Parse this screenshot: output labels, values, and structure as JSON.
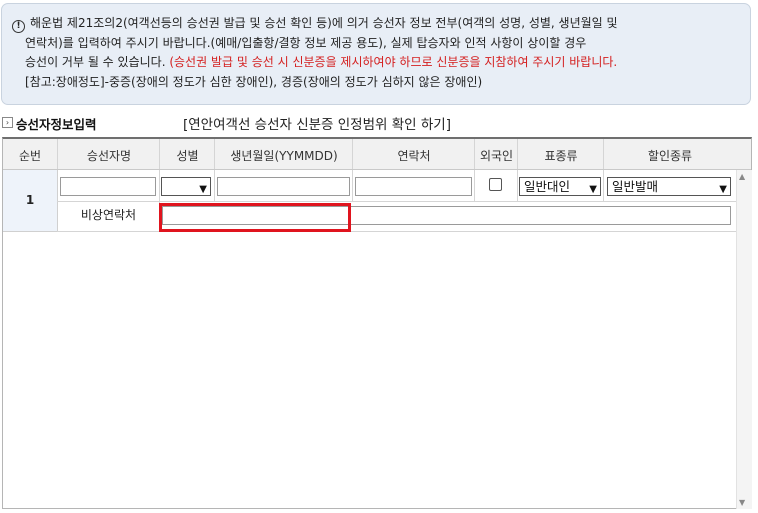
{
  "notice": {
    "icon": "info-icon",
    "line1": "해운법 제21조의2(여객선등의 승선권 발급 및 승선 확인 등)에 의거 승선자 정보 전부(여객의 성명, 성별, 생년월일 및",
    "line2": "연락처)를 입력하여 주시기 바랍니다.(예매/입출항/결항 정보 제공 용도), 실제 탑승자와 인적 사항이 상이할 경우",
    "line3_plain": "승선이 거부 될 수 있습니다. ",
    "line3_red": "(승선권 발급 및 승선 시 신분증을 제시하여야 하므로 신분증을 지참하여 주시기 바랍니다.",
    "line4": "[참고:장애정도]-중증(장애의 정도가 심한 장애인), 경증(장애의 정도가 심하지 않은 장애인)"
  },
  "section": {
    "title": "승선자정보입력",
    "id_link": "[연안여객선 승선자 신분증 인정범위 확인 하기]"
  },
  "table": {
    "headers": [
      "순번",
      "승선자명",
      "성별",
      "생년월일(YYMMDD)",
      "연락처",
      "외국인",
      "표종류",
      "할인종류"
    ],
    "row": {
      "number": "1",
      "name": "",
      "gender": "",
      "birth": "",
      "contact": "",
      "foreigner_checked": false,
      "ticket_type": "일반대인",
      "discount_type": "일반발매",
      "emergency_label": "비상연락처",
      "emergency_value": ""
    }
  },
  "colors": {
    "highlight": "#e0141e",
    "red_text": "#d42020",
    "notice_bg": "#e8eef6"
  }
}
